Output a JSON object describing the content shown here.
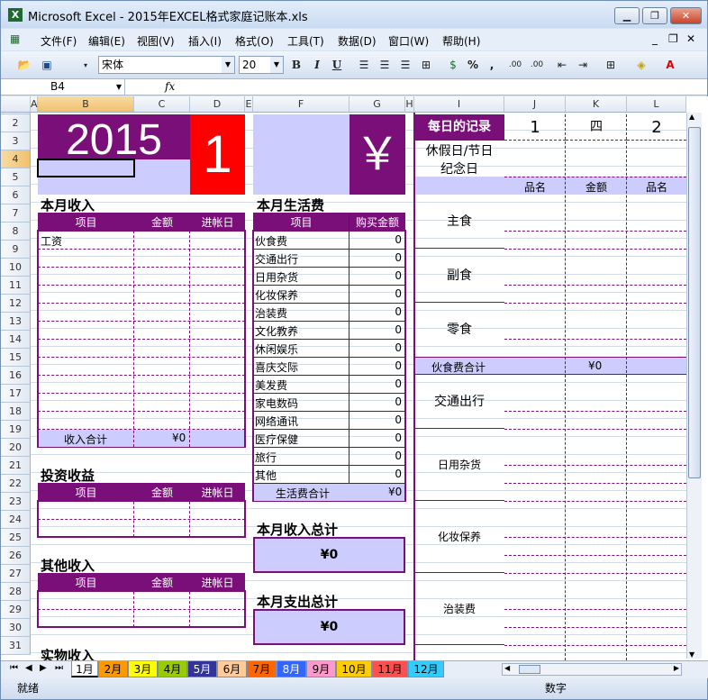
{
  "window": {
    "title": "Microsoft Excel - 2015年EXCEL格式家庭记账本.xls",
    "minimize": "▁",
    "restore": "❐",
    "close": "✕"
  },
  "menu": [
    "文件(F)",
    "编辑(E)",
    "视图(V)",
    "插入(I)",
    "格式(O)",
    "工具(T)",
    "数据(D)",
    "窗口(W)",
    "帮助(H)"
  ],
  "toolbar": {
    "font_name": "宋体",
    "font_size": "20",
    "bold": "B",
    "italic": "I",
    "underline": "U",
    "percent": "%",
    "comma": ",",
    "inc_dec": ".00",
    "dec_dec": ".00"
  },
  "formula_bar": {
    "name_box": "B4",
    "fx": "fx",
    "value": ""
  },
  "columns": [
    "A",
    "B",
    "C",
    "D",
    "E",
    "F",
    "G",
    "H",
    "I",
    "J",
    "K",
    "L"
  ],
  "rows": [
    "1",
    "2",
    "3",
    "4",
    "5",
    "6",
    "7",
    "8",
    "9",
    "10",
    "11",
    "12",
    "13",
    "14",
    "15",
    "16",
    "17",
    "18",
    "19",
    "20",
    "21",
    "22",
    "23",
    "24",
    "25",
    "26",
    "27",
    "28",
    "29",
    "30",
    "31"
  ],
  "sheet": {
    "year": "2015",
    "month": "1",
    "currency_symbol": "￥",
    "income": {
      "title": "本月收入",
      "headers": [
        "项目",
        "金额",
        "进帐日"
      ],
      "items": [
        "工资"
      ],
      "total_label": "收入合计",
      "total_value": "¥0"
    },
    "invest": {
      "title": "投资收益",
      "headers": [
        "项目",
        "金额",
        "进帐日"
      ]
    },
    "other": {
      "title": "其他收入",
      "headers": [
        "项目",
        "金额",
        "进帐日"
      ]
    },
    "goods": {
      "title": "实物收入"
    },
    "living": {
      "title": "本月生活费",
      "headers": [
        "项目",
        "购买金额"
      ],
      "items": [
        {
          "name": "伙食费",
          "value": "0"
        },
        {
          "name": "交通出行",
          "value": "0"
        },
        {
          "name": "日用杂货",
          "value": "0"
        },
        {
          "name": "化妆保养",
          "value": "0"
        },
        {
          "name": "治装费",
          "value": "0"
        },
        {
          "name": "文化教养",
          "value": "0"
        },
        {
          "name": "休闲娱乐",
          "value": "0"
        },
        {
          "name": "喜庆交际",
          "value": "0"
        },
        {
          "name": "美发费",
          "value": "0"
        },
        {
          "name": "家电数码",
          "value": "0"
        },
        {
          "name": "网络通讯",
          "value": "0"
        },
        {
          "name": "医疗保健",
          "value": "0"
        },
        {
          "name": "旅行",
          "value": "0"
        },
        {
          "name": "其他",
          "value": "0"
        }
      ],
      "total_label": "生活费合计",
      "total_value": "¥0"
    },
    "income_total": {
      "title": "本月收入总计",
      "value": "¥0"
    },
    "expense_total": {
      "title": "本月支出总计",
      "value": "¥0"
    },
    "daily": {
      "title": "每日的记录",
      "day1": "1",
      "weekday1": "四",
      "day2": "2",
      "holiday_label": "休假日/节日",
      "memorial_label": "纪念日",
      "col_headers": [
        "品名",
        "金额",
        "品名"
      ],
      "categories": [
        "主食",
        "副食",
        "零食"
      ],
      "food_total_label": "伙食费合计",
      "food_total_value": "¥0",
      "more_categories": [
        "交通出行",
        "日用杂货",
        "化妆保养",
        "治装费"
      ]
    }
  },
  "tabs": [
    {
      "label": "1月",
      "color": "#ffffff"
    },
    {
      "label": "2月",
      "color": "#ff9900"
    },
    {
      "label": "3月",
      "color": "#ffff00"
    },
    {
      "label": "4月",
      "color": "#99cc00"
    },
    {
      "label": "5月",
      "color": "#333399"
    },
    {
      "label": "6月",
      "color": "#ffcc99"
    },
    {
      "label": "7月",
      "color": "#ff6600"
    },
    {
      "label": "8月",
      "color": "#3366ff"
    },
    {
      "label": "9月",
      "color": "#ff99cc"
    },
    {
      "label": "10月",
      "color": "#ffcc00"
    },
    {
      "label": "11月",
      "color": "#ff5050"
    },
    {
      "label": "12月",
      "color": "#33ccff"
    }
  ],
  "status": {
    "ready": "就绪",
    "num": "数字"
  },
  "colors": {
    "purple": "#7a0f7a",
    "lavender": "#ccccff",
    "red": "#ff0000"
  }
}
